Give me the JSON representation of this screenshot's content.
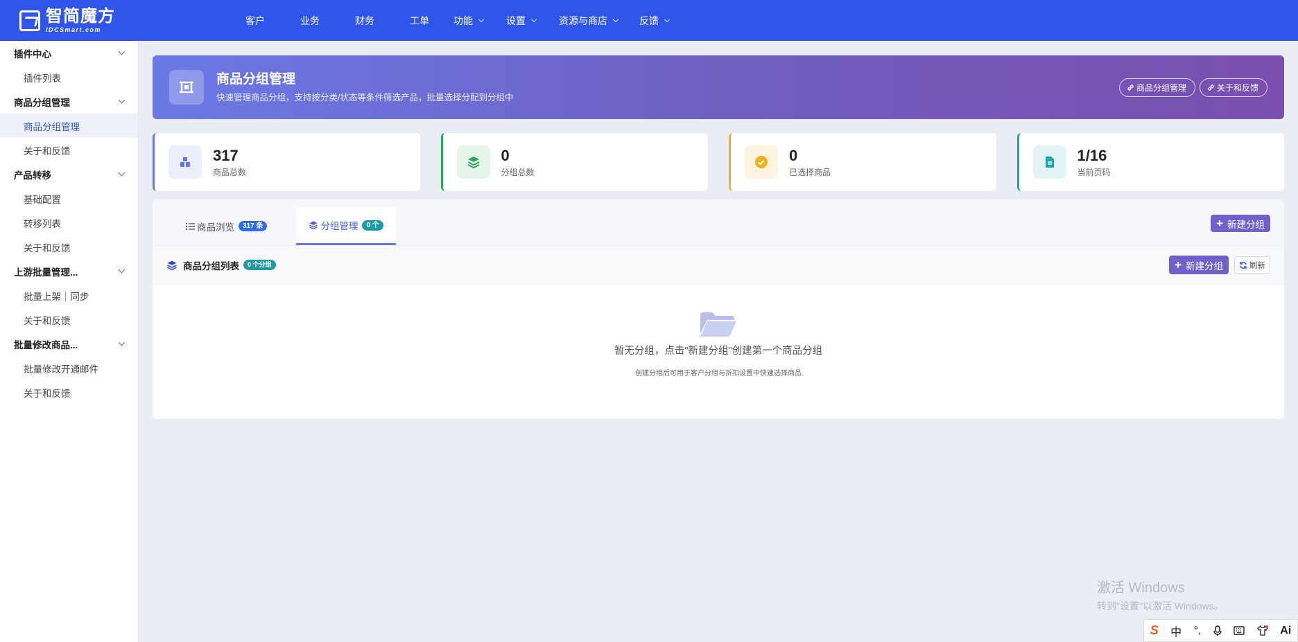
{
  "topbar": {
    "logo_cn": "智简魔方",
    "logo_en": "IDCSmart.com",
    "nav": [
      {
        "label": "客户",
        "has_menu": false
      },
      {
        "label": "业务",
        "has_menu": false
      },
      {
        "label": "财务",
        "has_menu": false
      },
      {
        "label": "工单",
        "has_menu": false
      },
      {
        "label": "功能",
        "has_menu": true
      },
      {
        "label": "设置",
        "has_menu": true
      },
      {
        "label": "资源与商店",
        "has_menu": true
      },
      {
        "label": "反馈",
        "has_menu": true
      }
    ]
  },
  "sidebar": {
    "groups": [
      {
        "label": "插件中心",
        "items": [
          {
            "label": "插件列表"
          }
        ]
      },
      {
        "label": "商品分组管理",
        "items": [
          {
            "label": "商品分组管理",
            "active": true
          },
          {
            "label": "关于和反馈"
          }
        ]
      },
      {
        "label": "产品转移",
        "items": [
          {
            "label": "基础配置"
          },
          {
            "label": "转移列表"
          },
          {
            "label": "关于和反馈"
          }
        ]
      },
      {
        "label": "上游批量管理...",
        "items": [
          {
            "label": "批量上架｜同步"
          },
          {
            "label": "关于和反馈"
          }
        ]
      },
      {
        "label": "批量修改商品...",
        "items": [
          {
            "label": "批量修改开通邮件"
          },
          {
            "label": "关于和反馈"
          }
        ]
      }
    ]
  },
  "hero": {
    "title": "商品分组管理",
    "subtitle": "快速管理商品分组，支持按分类/状态等条件筛选产品，批量选择分配到分组中",
    "buttons": [
      "商品分组管理",
      "关于和反馈"
    ]
  },
  "stats": [
    {
      "value": "317",
      "label": "商品总数",
      "color": "#6677e0",
      "bg": "#eceefb",
      "icon": "box-icon"
    },
    {
      "value": "0",
      "label": "分组总数",
      "color": "#2aa35b",
      "bg": "#e5f5ea",
      "icon": "layers-icon"
    },
    {
      "value": "0",
      "label": "已选择商品",
      "color": "#f2b01e",
      "bg": "#fdf3de",
      "icon": "check-circle-icon"
    },
    {
      "value": "1/16",
      "label": "当前页码",
      "color": "#1fa3a8",
      "bg": "#e2f4f5",
      "icon": "document-icon"
    }
  ],
  "tabs": [
    {
      "label": "商品浏览",
      "badge": "317 条",
      "badge_color": "#2f6de6",
      "icon": "list-icon",
      "active": false
    },
    {
      "label": "分组管理",
      "badge": "0 个",
      "badge_color": "#1f9aa5",
      "icon": "layers-icon",
      "active": true
    }
  ],
  "tab_action": "新建分组",
  "list": {
    "title": "商品分组列表",
    "badge": "0 个分组",
    "new_button": "新建分组",
    "refresh_button": "刷新"
  },
  "empty": {
    "message": "暂无分组，点击\"新建分组\"创建第一个商品分组",
    "hint": "创建分组后可用于客户分组与折扣设置中快速选择商品"
  },
  "watermark": {
    "line1": "激活 Windows",
    "line2": "转到\"设置\"以激活 Windows。"
  },
  "ime": {
    "lang": "中"
  }
}
